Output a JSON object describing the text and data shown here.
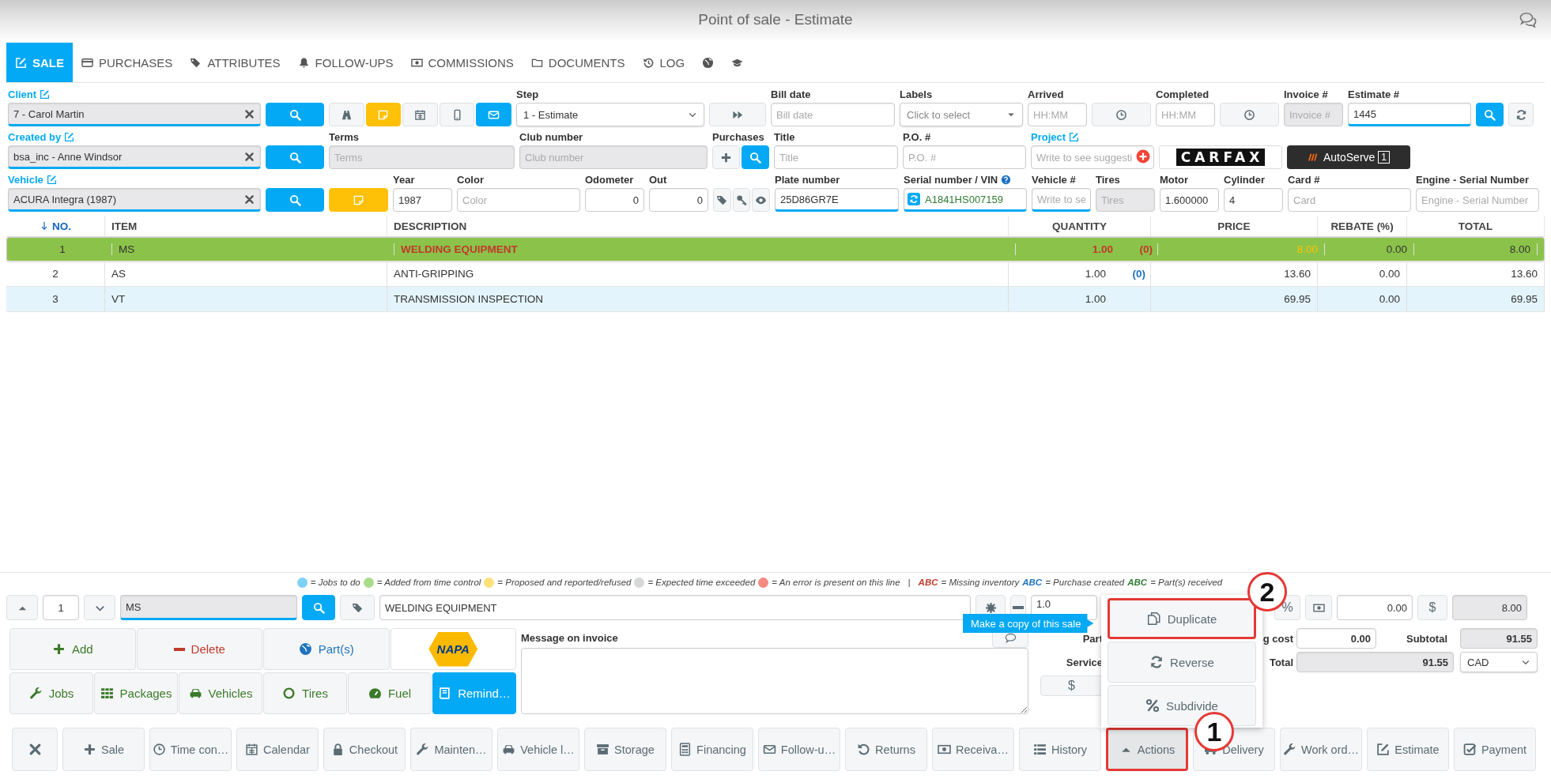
{
  "window": {
    "title": "Point of sale - Estimate"
  },
  "tabs": [
    {
      "label": "SALE",
      "selected": true
    },
    {
      "label": "PURCHASES",
      "selected": false
    },
    {
      "label": "ATTRIBUTES",
      "selected": false
    },
    {
      "label": "FOLLOW-UPS",
      "selected": false
    },
    {
      "label": "COMMISSIONS",
      "selected": false
    },
    {
      "label": "DOCUMENTS",
      "selected": false
    },
    {
      "label": "LOG",
      "selected": false
    },
    {
      "selected": false
    },
    {
      "selected": false
    }
  ],
  "form": {
    "top_line": [
      {
        "kind": "field",
        "label": "Client",
        "link": true,
        "value": "7 - Carol Martin",
        "readonly": true,
        "focused": true,
        "clearable": true
      },
      {
        "kind": "button"
      },
      {
        "kind": "buttons"
      },
      {
        "kind": "select",
        "label": "Step",
        "value": "1 - Estimate"
      },
      {
        "kind": "button"
      },
      {
        "kind": "field",
        "label": "Bill date",
        "placeholder": "Bill date",
        "readonly": false,
        "focused": false
      },
      {
        "kind": "select",
        "label": "Labels",
        "placeholder": "Click to select"
      },
      {
        "kind": "field",
        "label": "Arrived",
        "placeholder": "HH:MM",
        "readonly": false,
        "focused": false
      },
      {
        "kind": "button"
      },
      {
        "kind": "field",
        "label": "Completed",
        "placeholder": "HH:MM",
        "readonly": false,
        "focused": false
      },
      {
        "kind": "button"
      },
      {
        "kind": "field",
        "label": "Invoice #",
        "placeholder": "Invoice #",
        "readonly": true,
        "focused": false
      },
      {
        "kind": "field",
        "label": "Estimate #",
        "value": "1445",
        "readonly": false,
        "focused": true
      },
      {
        "kind": "button"
      },
      {
        "kind": "button"
      }
    ],
    "middle_line": [
      {
        "kind": "field",
        "label": "Created by",
        "link": true,
        "value": "bsa_inc - Anne Windsor",
        "readonly": true,
        "focused": true,
        "clearable": true
      },
      {
        "kind": "button"
      },
      {
        "kind": "field",
        "label": "Terms",
        "placeholder": "Terms",
        "readonly": true,
        "focused": false
      },
      {
        "kind": "field",
        "label": "Club number",
        "placeholder": "Club number",
        "readonly": true,
        "focused": false
      },
      {
        "kind": "buttons",
        "label": "Purchases"
      },
      {
        "kind": "field",
        "label": "Title",
        "placeholder": "Title",
        "readonly": false,
        "focused": false
      },
      {
        "kind": "field",
        "label": "P.O. #",
        "placeholder": "P.O. #",
        "readonly": false,
        "focused": false
      },
      {
        "kind": "field",
        "label": "Project",
        "link": true,
        "placeholder": "Write to see suggesti",
        "readonly": false,
        "focused": false,
        "addable": true
      },
      {
        "kind": "wordmark",
        "text": "CARFAX"
      },
      {
        "kind": "emblem",
        "text": "AutoServe",
        "badge": "1"
      }
    ],
    "bottom_line": [
      {
        "kind": "field",
        "label": "Vehicle",
        "link": true,
        "value": "ACURA Integra (1987)",
        "readonly": true,
        "focused": true,
        "clearable": true
      },
      {
        "kind": "button"
      },
      {
        "kind": "button"
      },
      {
        "kind": "field",
        "label": "Year",
        "value": "1987",
        "readonly": false,
        "focused": false
      },
      {
        "kind": "field",
        "label": "Color",
        "placeholder": "Color",
        "readonly": false,
        "focused": false
      },
      {
        "kind": "number",
        "label": "Odometer",
        "value": "0",
        "readonly": false,
        "focused": false
      },
      {
        "kind": "number",
        "label": "Out",
        "value": "0",
        "readonly": false,
        "focused": false
      },
      {
        "kind": "buttons"
      },
      {
        "kind": "field",
        "label": "Plate number",
        "value": "25D86GR7E",
        "readonly": false,
        "focused": true
      },
      {
        "kind": "field",
        "label": "Serial number / VIN",
        "help": true,
        "value": "A1841HS007159",
        "readonly": false,
        "focused": true,
        "valid": true
      },
      {
        "kind": "field",
        "label": "Vehicle #",
        "placeholder": "Write to se",
        "readonly": false,
        "focused": true
      },
      {
        "kind": "field",
        "label": "Tires",
        "placeholder": "Tires",
        "readonly": true,
        "focused": false
      },
      {
        "kind": "field",
        "label": "Motor",
        "value": "1.600000",
        "readonly": false,
        "focused": false
      },
      {
        "kind": "field",
        "label": "Cylinder",
        "value": "4",
        "readonly": false,
        "focused": false
      },
      {
        "kind": "field",
        "label": "Card #",
        "placeholder": "Card",
        "readonly": false,
        "focused": false
      },
      {
        "kind": "field",
        "label": "Engine - Serial Number",
        "placeholder": "Engine - Serial Number",
        "readonly": false,
        "focused": false
      }
    ]
  },
  "table": {
    "columns": [
      {
        "label": "NO.",
        "sorted": true
      },
      {
        "label": "ITEM",
        "sorted": false
      },
      {
        "label": "DESCRIPTION",
        "sorted": false
      },
      {
        "label": "QUANTITY",
        "sorted": false
      },
      {
        "label": "PRICE",
        "sorted": false
      },
      {
        "label": "REBATE (%)",
        "sorted": false
      },
      {
        "label": "TOTAL",
        "sorted": false
      }
    ],
    "rows": [
      {
        "no": "1",
        "item": "MS",
        "description": "WELDING EQUIPMENT",
        "quantity": "1.00",
        "reserved": "(0)",
        "color": "#c0392b",
        "price": "8.00",
        "rebate": "0.00",
        "total": "8.00",
        "selected": true
      },
      {
        "no": "2",
        "item": "AS",
        "description": "ANTI-GRIPPING",
        "quantity": "1.00",
        "reserved": "(0)",
        "color": "#1e73be",
        "price": "13.60",
        "rebate": "0.00",
        "total": "13.60",
        "selected": false
      },
      {
        "no": "3",
        "item": "VT",
        "description": "TRANSMISSION INSPECTION",
        "quantity": "1.00",
        "price": "69.95",
        "rebate": "0.00",
        "total": "69.95",
        "selected": false
      }
    ]
  },
  "legend": {
    "items": [
      {
        "kind": "dot",
        "color": "#7fd0f5",
        "text": "= Jobs to do"
      },
      {
        "kind": "dot",
        "color": "#a9dc8a",
        "text": "= Added from time control"
      },
      {
        "kind": "dot",
        "color": "#ffe17a",
        "text": "= Proposed and reported/refused"
      },
      {
        "kind": "dot",
        "color": "#d6d8da",
        "text": "= Expected time exceeded"
      },
      {
        "kind": "dot",
        "color": "#f28b82",
        "text": "= An error is present on this line"
      },
      {
        "kind": "separator",
        "text": "|"
      },
      {
        "kind": "mark",
        "mark": "ABC",
        "color": "#c0392b",
        "text": "= Missing inventory"
      },
      {
        "kind": "mark",
        "mark": "ABC",
        "color": "#1e73be",
        "text": "= Purchase created"
      },
      {
        "kind": "mark",
        "mark": "ABC",
        "color": "#2e7d32",
        "text": "= Part(s) received"
      }
    ]
  },
  "item_editor": {
    "line": "1",
    "code": "MS",
    "description": "WELDING EQUIPMENT",
    "quantity": "1.0",
    "percent_button": "%",
    "discount": "0.00",
    "dollar_button": "$",
    "amount": "8.00"
  },
  "tools": [
    [
      {
        "kind": "button",
        "label": "Add"
      },
      {
        "kind": "button",
        "label": "Delete"
      },
      {
        "kind": "button",
        "label": "Part(s)"
      },
      {
        "kind": "logo",
        "text": "NAPA"
      }
    ],
    [
      {
        "label": "Jobs",
        "selected": false
      },
      {
        "label": "Packages",
        "selected": false
      },
      {
        "label": "Vehicles",
        "selected": false
      },
      {
        "label": "Tires",
        "selected": false
      },
      {
        "label": "Fuel",
        "selected": false
      },
      {
        "label": "Remind…",
        "selected": true
      }
    ]
  ],
  "message": {
    "label": "Message on invoice"
  },
  "totals": {
    "parts_label": "Part",
    "service_label": "Service",
    "service_button": "$",
    "shipping_label": "g cost",
    "shipping": "0.00",
    "subtotal_label": "Subtotal",
    "subtotal": "91.55",
    "total_label": "Total",
    "total": "91.55",
    "currency": "CAD"
  },
  "toolbar": [
    {
      "expanded": false,
      "highlighted": false
    },
    {
      "label": "Sale",
      "expanded": false,
      "highlighted": false
    },
    {
      "label": "Time con…",
      "expanded": false,
      "highlighted": false
    },
    {
      "label": "Calendar",
      "expanded": false,
      "highlighted": false
    },
    {
      "label": "Checkout",
      "expanded": false,
      "highlighted": false
    },
    {
      "label": "Mainten…",
      "expanded": false,
      "highlighted": false
    },
    {
      "label": "Vehicle l…",
      "expanded": false,
      "highlighted": false
    },
    {
      "label": "Storage",
      "expanded": false,
      "highlighted": false
    },
    {
      "label": "Financing",
      "expanded": false,
      "highlighted": false
    },
    {
      "label": "Follow-u…",
      "expanded": false,
      "highlighted": false
    },
    {
      "label": "Returns",
      "expanded": false,
      "highlighted": false
    },
    {
      "label": "Receiva…",
      "expanded": false,
      "highlighted": false
    },
    {
      "label": "History",
      "expanded": false,
      "highlighted": false
    },
    {
      "label": "Actions",
      "expanded": true,
      "highlighted": true
    },
    {
      "label": "Delivery",
      "expanded": false,
      "highlighted": false
    },
    {
      "label": "Work ord…",
      "expanded": false,
      "highlighted": false
    },
    {
      "label": "Estimate",
      "expanded": false,
      "highlighted": false
    },
    {
      "label": "Payment",
      "expanded": false,
      "highlighted": false
    }
  ],
  "menu": {
    "items": [
      {
        "label": "Duplicate",
        "highlighted": true
      },
      {
        "label": "Reverse",
        "highlighted": false
      },
      {
        "label": "Subdivide",
        "highlighted": false
      }
    ],
    "tooltip": "Make a copy of this sale"
  },
  "annotations": [
    {
      "text": "1"
    },
    {
      "text": "2"
    }
  ]
}
